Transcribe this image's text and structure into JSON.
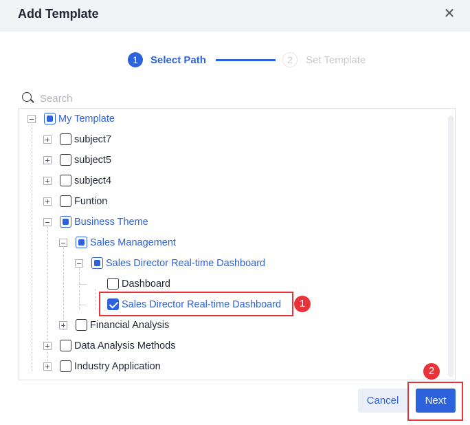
{
  "dialog": {
    "title": "Add Template",
    "close_icon": "close-icon"
  },
  "steps": [
    {
      "num": "1",
      "label": "Select Path",
      "state": "active"
    },
    {
      "num": "2",
      "label": "Set Template",
      "state": "inactive"
    }
  ],
  "search": {
    "placeholder": "Search",
    "value": ""
  },
  "tree": [
    {
      "label": "My Template",
      "level": 0,
      "expander": "minus",
      "check": "half"
    },
    {
      "label": "subject7",
      "level": 1,
      "expander": "plus",
      "check": "off"
    },
    {
      "label": "subject5",
      "level": 1,
      "expander": "plus",
      "check": "off"
    },
    {
      "label": "subject4",
      "level": 1,
      "expander": "plus",
      "check": "off"
    },
    {
      "label": "Funtion",
      "level": 1,
      "expander": "plus",
      "check": "off"
    },
    {
      "label": "Business Theme",
      "level": 1,
      "expander": "minus",
      "check": "half"
    },
    {
      "label": "Sales Management",
      "level": 2,
      "expander": "minus",
      "check": "half"
    },
    {
      "label": "Sales Director Real-time Dashboard",
      "level": 3,
      "expander": "minus",
      "check": "half"
    },
    {
      "label": "Dashboard",
      "level": 4,
      "expander": "none",
      "check": "off"
    },
    {
      "label": "Sales Director Real-time Dashboard",
      "level": 4,
      "expander": "none",
      "check": "on"
    },
    {
      "label": "Financial Analysis",
      "level": 2,
      "expander": "plus",
      "check": "off"
    },
    {
      "label": "Data Analysis Methods",
      "level": 1,
      "expander": "plus",
      "check": "off"
    },
    {
      "label": "Industry Application",
      "level": 1,
      "expander": "plus",
      "check": "off"
    }
  ],
  "annotations": {
    "badge1": "1",
    "badge2": "2"
  },
  "footer": {
    "cancel": "Cancel",
    "next": "Next"
  },
  "colors": {
    "accent": "#2d62dc",
    "highlight": "#e8333a"
  }
}
